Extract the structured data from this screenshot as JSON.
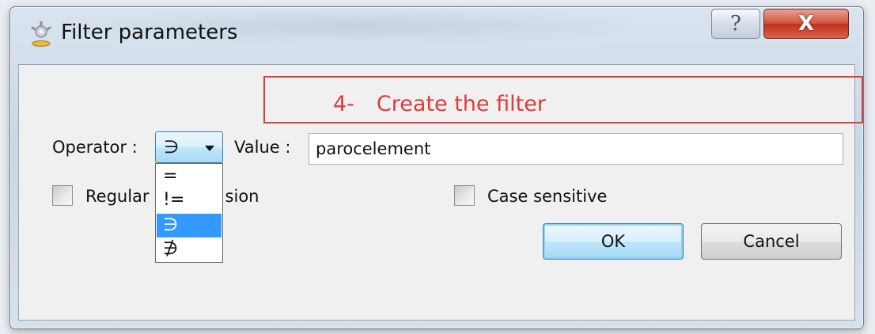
{
  "window": {
    "title": "Filter parameters"
  },
  "titlebar": {
    "help_label": "?",
    "close_label": "X"
  },
  "annotation": {
    "number": "4-",
    "text": "Create the filter",
    "color": "#e03a3a"
  },
  "form": {
    "operator_label": "Operator :",
    "operator_selected": "∋",
    "value_label": "Value :",
    "value": "parocelement",
    "operator_options": [
      "=",
      "!=",
      "∋",
      "∌"
    ],
    "highlighted_option_index": 2,
    "regex_label_visible_start": "Regular",
    "regex_label_visible_end": "sion",
    "regex_checked": false,
    "case_sensitive_label": "Case sensitive",
    "case_sensitive_checked": false
  },
  "buttons": {
    "ok_label": "OK",
    "cancel_label": "Cancel"
  },
  "colors": {
    "highlight": "#3399ff",
    "close_button": "#c8462f"
  },
  "icons": {
    "app": "app-gear-icon",
    "help": "help-icon",
    "close": "close-icon",
    "dropdown": "chevron-down-icon"
  }
}
